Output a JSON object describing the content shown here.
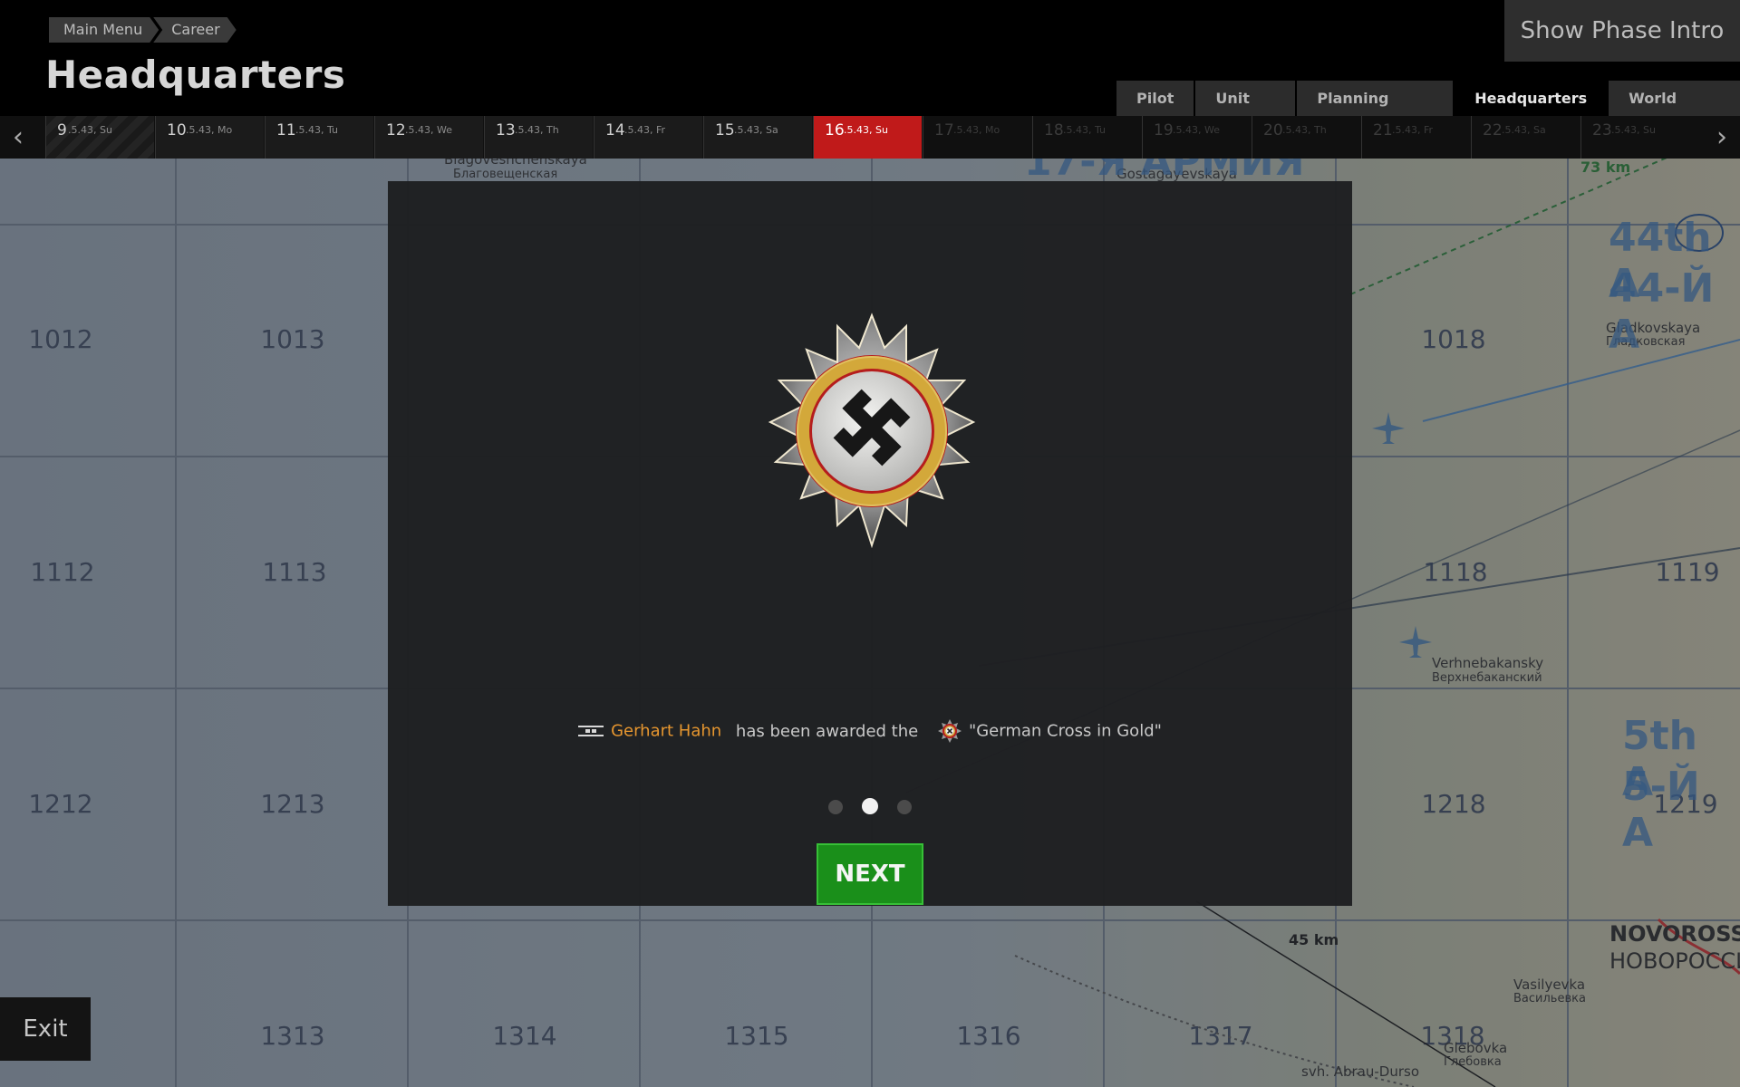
{
  "breadcrumb": {
    "items": [
      "Main Menu",
      "Career"
    ]
  },
  "page_title": "Headquarters",
  "phase_button": "Show Phase Intro",
  "tabs": [
    {
      "label": "Pilot"
    },
    {
      "label": "Unit HQ"
    },
    {
      "label": "Planning Room"
    },
    {
      "label": "Headquarters",
      "active": true
    },
    {
      "label": "World News"
    }
  ],
  "timeline": {
    "days": [
      {
        "num": "9",
        "sub": ".5.43, Su"
      },
      {
        "num": "10",
        "sub": ".5.43, Mo"
      },
      {
        "num": "11",
        "sub": ".5.43, Tu"
      },
      {
        "num": "12",
        "sub": ".5.43, We"
      },
      {
        "num": "13",
        "sub": ".5.43, Th"
      },
      {
        "num": "14",
        "sub": ".5.43, Fr"
      },
      {
        "num": "15",
        "sub": ".5.43, Sa"
      },
      {
        "num": "16",
        "sub": ".5.43, Su"
      },
      {
        "num": "17",
        "sub": ".5.43, Mo"
      },
      {
        "num": "18",
        "sub": ".5.43, Tu"
      },
      {
        "num": "19",
        "sub": ".5.43, We"
      },
      {
        "num": "20",
        "sub": ".5.43, Th"
      },
      {
        "num": "21",
        "sub": ".5.43, Fr"
      },
      {
        "num": "22",
        "sub": ".5.43, Sa"
      },
      {
        "num": "23",
        "sub": ".5.43, Su"
      }
    ],
    "current_index": 7
  },
  "map": {
    "squares": [
      "1012",
      "1013",
      "1018",
      "1112",
      "1113",
      "1118",
      "1119",
      "1212",
      "1213",
      "1218",
      "1219",
      "1313",
      "1314",
      "1315",
      "1316",
      "1317",
      "1318"
    ],
    "places": {
      "blagoveshchenskaya": "Blagoveshchenskaya",
      "blagoveshchenskaya_ru": "Благовещенская",
      "gostagayevskaya": "Gostagayevskaya",
      "gladkovskaya": "Gladkovskaya",
      "gladkovskaya_ru": "Гладковская",
      "verhnebakansky": "Verhnebakansky",
      "verhnebakansky_ru": "Верхнебаканский",
      "novorossiysk": "NOVOROSSI",
      "novorossiysk_ru": "НОВОРОССИ",
      "vasilyevka": "Vasilyevka",
      "vasilyevka_ru": "Васильевка",
      "glebovka": "Glebovka",
      "glebovka_ru": "Глебовка",
      "abrau": "svh. Abrau-Durso"
    },
    "labels": {
      "army17": "17-Я АРМИЯ",
      "army44": "44th A",
      "army44_ru": "44-Й А",
      "army5": "5th A",
      "army5_ru": "5-Й А",
      "dist73": "73 km",
      "dist45": "45 km"
    }
  },
  "award": {
    "pilot_name": "Gerhart Hahn",
    "text": "has been awarded the",
    "medal_name": "\"German Cross in Gold\""
  },
  "pagination": {
    "total": 3,
    "current": 2
  },
  "next_button": "NEXT",
  "exit_button": "Exit",
  "colors": {
    "accent_name": "#e6962f",
    "next_bg": "#1a8f1a",
    "current_day": "#c01a1a"
  }
}
